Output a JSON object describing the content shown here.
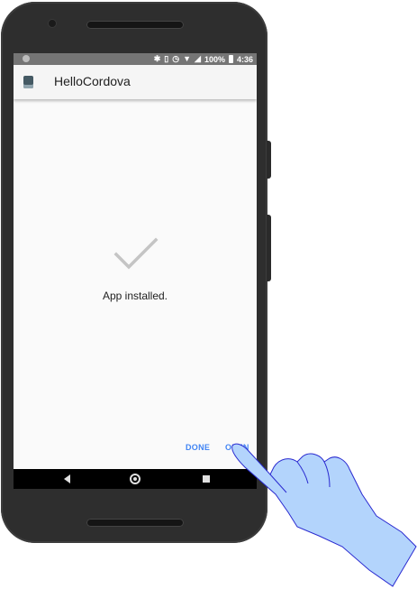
{
  "status_bar": {
    "battery": "100%",
    "time": "4:36",
    "icons": [
      "bluetooth-icon",
      "vibrate-icon",
      "alarm-icon",
      "wifi-icon",
      "signal-icon",
      "battery-icon"
    ]
  },
  "app_bar": {
    "title": "HelloCordova",
    "icon": "app-icon"
  },
  "content": {
    "icon": "checkmark-icon",
    "message": "App installed."
  },
  "actions": {
    "done_label": "DONE",
    "open_label": "OPEN"
  },
  "nav_bar": {
    "buttons": [
      "back-icon",
      "home-icon",
      "recents-icon"
    ]
  },
  "colors": {
    "accent": "#4285f4",
    "status_bar": "#757575",
    "hand_fill": "#b3d4fc",
    "hand_stroke": "#2a2ad0"
  }
}
